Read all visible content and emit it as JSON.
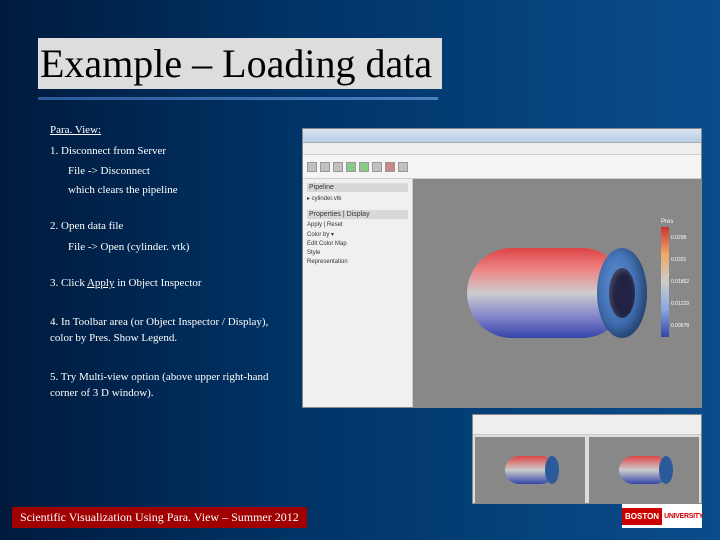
{
  "title": "Example – Loading data",
  "heading": "Para. View:",
  "steps": {
    "s1": "1. Disconnect from Server",
    "s1a": "File -> Disconnect",
    "s1b": "which clears the pipeline",
    "s2": "2. Open data file",
    "s2a": "File -> Open (cylinder. vtk)",
    "s3a": "3. Click ",
    "s3apply": "Apply",
    "s3b": " in Object Inspector",
    "s4": "4. In Toolbar area (or Object Inspector / Display), color by Pres.  Show Legend.",
    "s5": "5. Try Multi-view option (above upper right-hand corner of 3 D window)."
  },
  "colorbar": {
    "label": "Pres",
    "ticks": [
      "0.0298",
      "0.0331",
      "0.01802",
      "0.01229",
      "0.00678"
    ]
  },
  "footer": "Scientific Visualization Using Para. View – Summer 2012",
  "logo": {
    "short": "BOSTON",
    "text": "UNIVERSITY"
  }
}
